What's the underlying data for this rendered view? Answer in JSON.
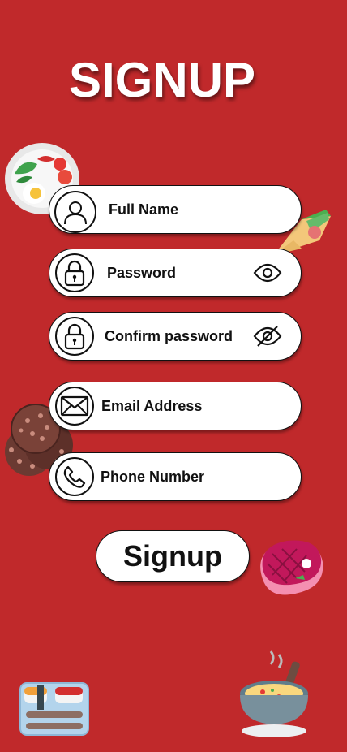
{
  "title": "SIGNUP",
  "fields": {
    "full_name": "Full Name",
    "password": "Password",
    "confirm_password": "Confirm password",
    "email": "Email Address",
    "phone": "Phone Number"
  },
  "signup_button": "Signup",
  "icons": {
    "user": "user-icon",
    "lock": "lock-icon",
    "eye": "eye-icon",
    "eye_off": "eye-off-icon",
    "mail": "mail-icon",
    "phone": "phone-icon"
  },
  "colors": {
    "background": "#c0292b",
    "field_bg": "#ffffff",
    "text": "#111111"
  }
}
